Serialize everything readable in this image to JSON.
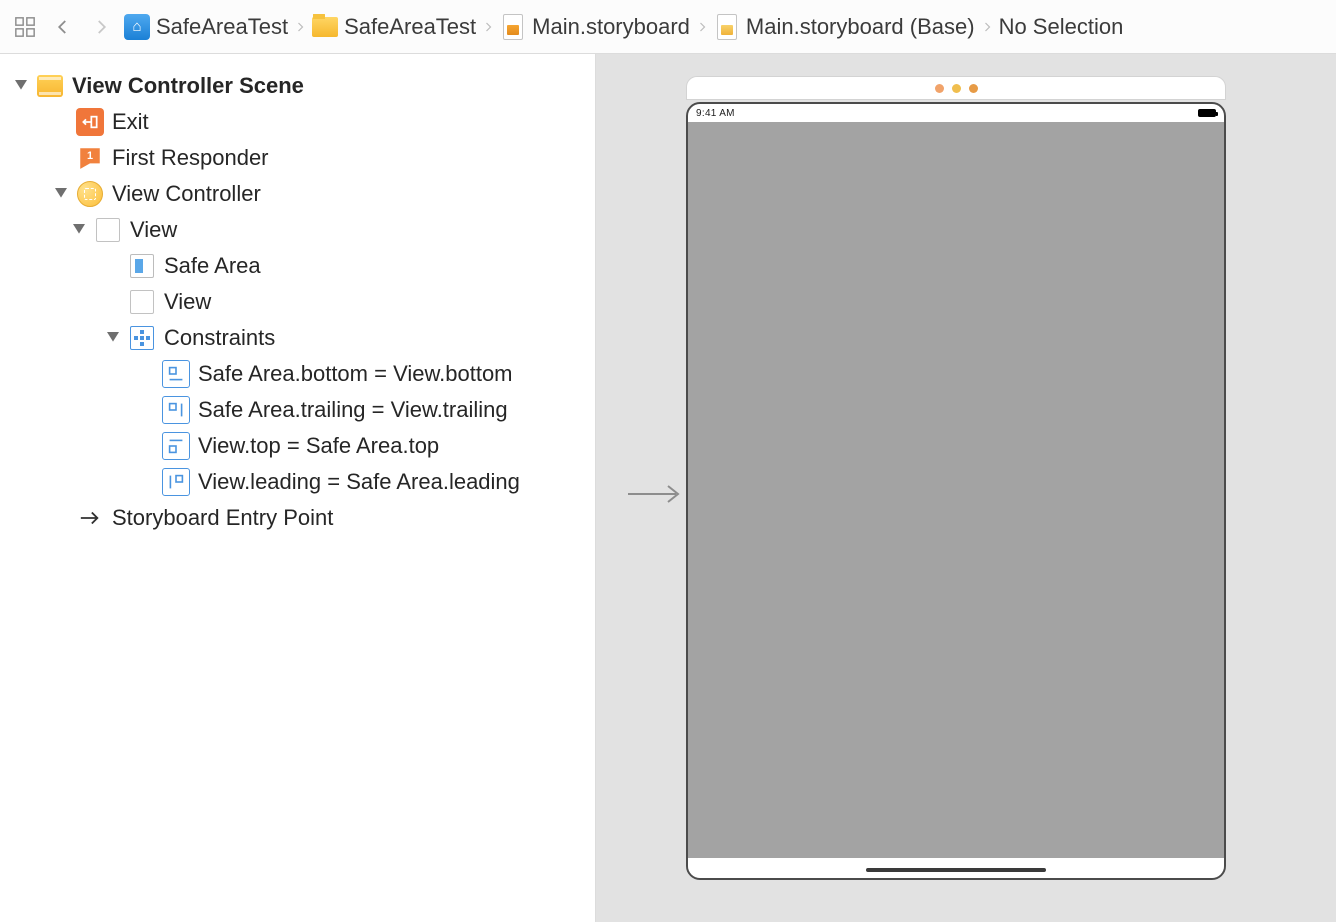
{
  "toolbar": {
    "related_items_tooltip": "Related Items"
  },
  "breadcrumbs": [
    {
      "icon": "app",
      "label": "SafeAreaTest"
    },
    {
      "icon": "folder",
      "label": "SafeAreaTest"
    },
    {
      "icon": "storyboard",
      "label": "Main.storyboard"
    },
    {
      "icon": "storyboard-alt",
      "label": "Main.storyboard (Base)"
    },
    {
      "icon": "none",
      "label": "No Selection"
    }
  ],
  "outline": [
    {
      "id": "scene",
      "indent": 0,
      "disclosure": "open",
      "icon": "scene",
      "label": "View Controller Scene",
      "bold": true
    },
    {
      "id": "exit",
      "indent": 1,
      "disclosure": "none",
      "icon": "exit",
      "label": "Exit"
    },
    {
      "id": "firstresp",
      "indent": 1,
      "disclosure": "none",
      "icon": "firstresp",
      "label": "First Responder"
    },
    {
      "id": "vc",
      "indent": 1,
      "disclosure": "open",
      "icon": "vc",
      "label": "View Controller"
    },
    {
      "id": "view",
      "indent": 2,
      "disclosure": "open",
      "icon": "view",
      "label": "View"
    },
    {
      "id": "safearea",
      "indent": 3,
      "disclosure": "none",
      "icon": "safearea",
      "label": "Safe Area"
    },
    {
      "id": "subview",
      "indent": 3,
      "disclosure": "none",
      "icon": "view",
      "label": "View"
    },
    {
      "id": "constraints",
      "indent": 3,
      "disclosure": "open",
      "icon": "constraints",
      "label": "Constraints"
    },
    {
      "id": "c-bottom",
      "indent": 4,
      "disclosure": "none",
      "icon": "con-bottom",
      "label": "Safe Area.bottom = View.bottom"
    },
    {
      "id": "c-trailing",
      "indent": 4,
      "disclosure": "none",
      "icon": "con-trailing",
      "label": "Safe Area.trailing = View.trailing"
    },
    {
      "id": "c-top",
      "indent": 4,
      "disclosure": "none",
      "icon": "con-top",
      "label": "View.top = Safe Area.top"
    },
    {
      "id": "c-leading",
      "indent": 4,
      "disclosure": "none",
      "icon": "con-leading",
      "label": "View.leading = Safe Area.leading"
    },
    {
      "id": "entry",
      "indent": 1,
      "disclosure": "none",
      "icon": "arrow",
      "label": "Storyboard Entry Point"
    }
  ],
  "canvas": {
    "status_time": "9:41 AM"
  }
}
